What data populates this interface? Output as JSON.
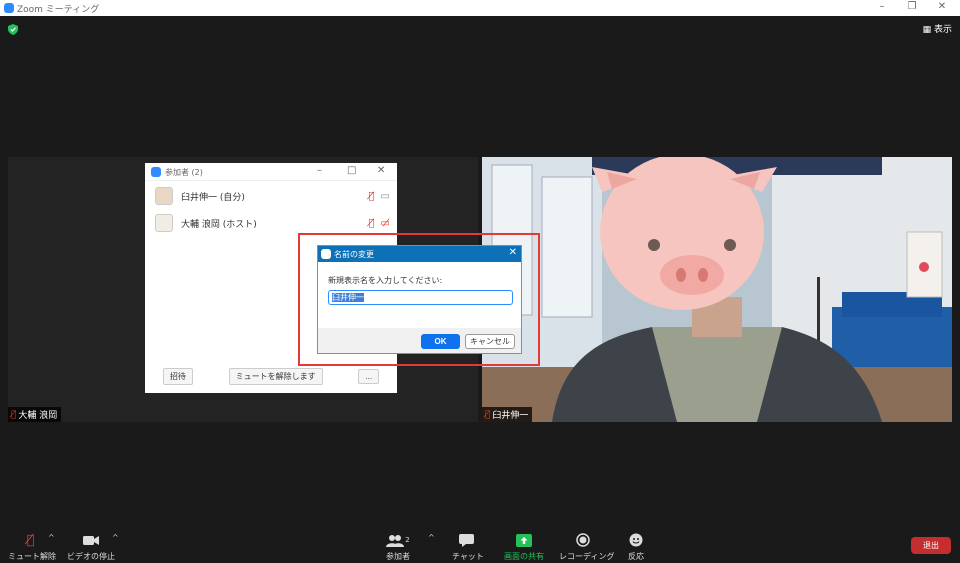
{
  "window": {
    "title": "Zoom ミーティング"
  },
  "header": {
    "view_label": "表示"
  },
  "tiles": [
    {
      "name": "大輔 浪岡"
    },
    {
      "name": "臼井伸一"
    }
  ],
  "participants_panel": {
    "title": "参加者 (2)",
    "items": [
      {
        "name": "臼井伸一 (自分)"
      },
      {
        "name": "大輔 浪岡 (ホスト)"
      }
    ],
    "invite_label": "招待",
    "unmute_all_label": "ミュートを解除します",
    "more_label": "..."
  },
  "rename_dialog": {
    "title": "名前の変更",
    "prompt": "新規表示名を入力してください:",
    "value": "臼井伸一",
    "ok_label": "OK",
    "cancel_label": "キャンセル"
  },
  "toolbar": {
    "unmute_label": "ミュート解除",
    "stop_video_label": "ビデオの停止",
    "participants_label": "参加者",
    "participants_count": "2",
    "chat_label": "チャット",
    "share_label": "画面の共有",
    "record_label": "レコーディング",
    "reactions_label": "反応",
    "leave_label": "退出"
  },
  "colors": {
    "accent": "#0e72ed",
    "share_green": "#24c15a",
    "leave_red": "#c52e2e",
    "highlight": "#e53935"
  }
}
